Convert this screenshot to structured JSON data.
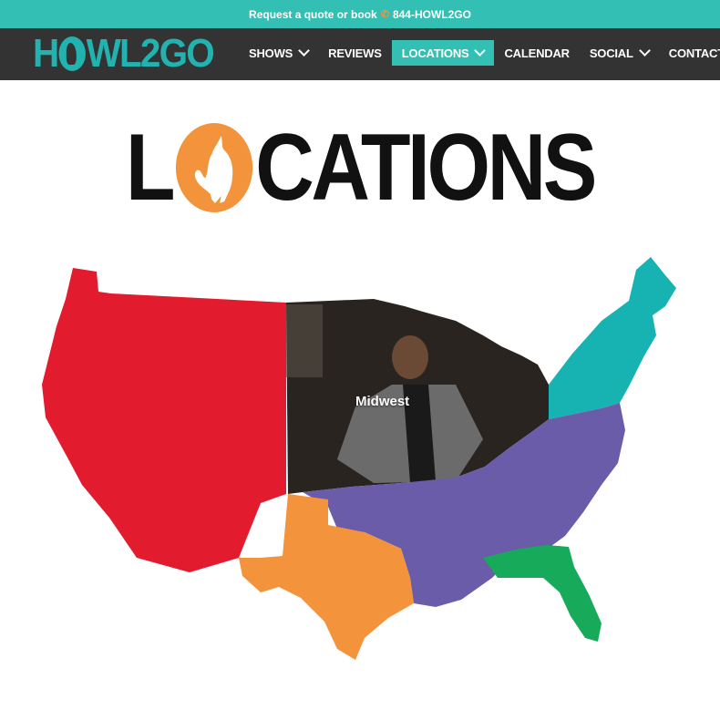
{
  "topbar": {
    "text": "Request a quote or book",
    "phone": "844-HOWL2GO"
  },
  "brand": {
    "name": "HOWL2GO",
    "colors": {
      "teal": "#33bfb3",
      "orange": "#f3943c",
      "dark": "#333333"
    }
  },
  "nav": {
    "items": [
      {
        "label": "SHOWS",
        "dropdown": true
      },
      {
        "label": "REVIEWS",
        "dropdown": false
      },
      {
        "label": "LOCATIONS",
        "dropdown": true,
        "active": true
      },
      {
        "label": "CALENDAR",
        "dropdown": false
      },
      {
        "label": "SOCIAL",
        "dropdown": true
      },
      {
        "label": "CONTACT",
        "dropdown": true
      }
    ]
  },
  "hero": {
    "title_left": "L",
    "title_right": "CATIONS"
  },
  "map": {
    "regions": [
      {
        "name": "West",
        "color": "#e21b2e"
      },
      {
        "name": "Midwest",
        "color": "#3a3a3a"
      },
      {
        "name": "Northeast",
        "color": "#17b3b3"
      },
      {
        "name": "Southeast",
        "color": "#6a5ca8"
      },
      {
        "name": "Texas",
        "color": "#f3943c"
      },
      {
        "name": "Florida",
        "color": "#16aa5a"
      }
    ],
    "hover_label": "Midwest"
  }
}
